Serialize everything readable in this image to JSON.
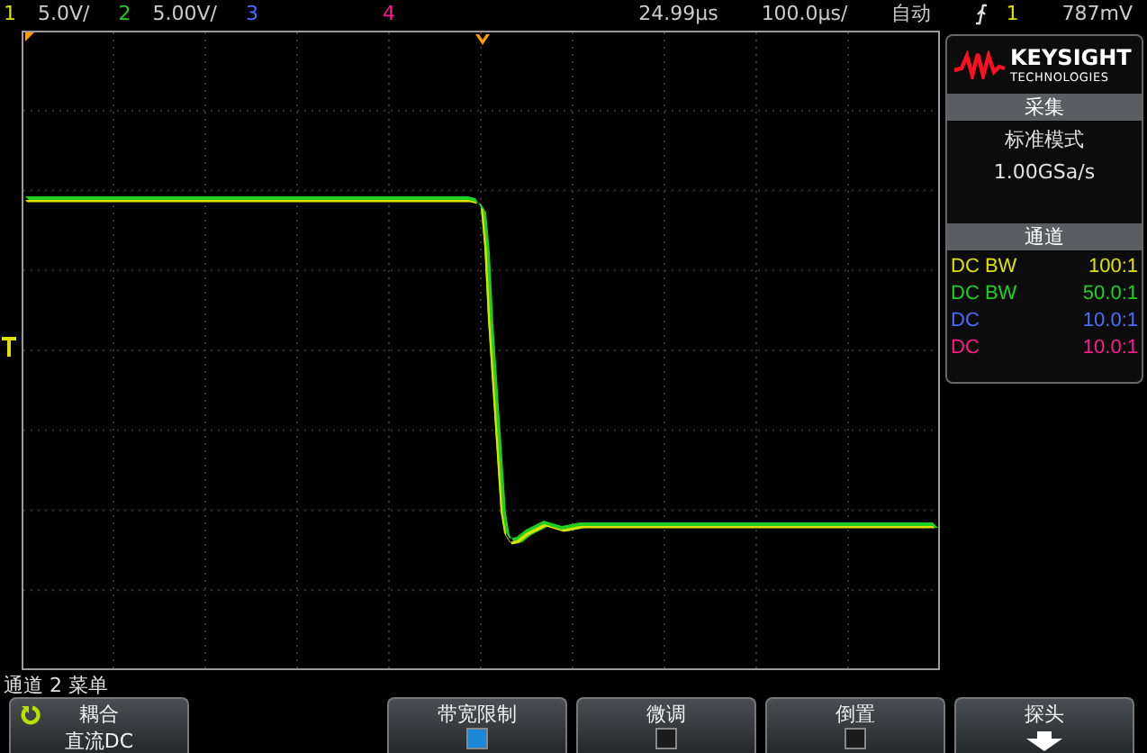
{
  "top_bar": {
    "channels": [
      {
        "number": "1",
        "scale": "5.0V/",
        "color": "#e0e000"
      },
      {
        "number": "2",
        "scale": "5.00V/",
        "color": "#20d020"
      },
      {
        "number": "3",
        "color": "#4a6cff"
      },
      {
        "number": "4",
        "color": "#ff1a8c"
      }
    ],
    "delay": "24.99µs",
    "timebase": "100.0µs/",
    "trigger_mode": "自动",
    "trigger_source": "1",
    "trigger_level": "787mV"
  },
  "sidebar": {
    "logo": {
      "brand": "KEYSIGHT",
      "subtitle": "TECHNOLOGIES"
    },
    "acquisition": {
      "header": "采集",
      "mode": "标准模式",
      "sample_rate": "1.00GSa/s"
    },
    "channels": {
      "header": "通道",
      "rows": [
        {
          "coupling": "DC BW",
          "probe": "100:1",
          "color": "#e0e000"
        },
        {
          "coupling": "DC BW",
          "probe": "50.0:1",
          "color": "#20d020"
        },
        {
          "coupling": "DC",
          "probe": "10.0:1",
          "color": "#4a6cff"
        },
        {
          "coupling": "DC",
          "probe": "10.0:1",
          "color": "#ff1a8c"
        }
      ]
    }
  },
  "menu": {
    "title": "通道 2 菜单",
    "softkeys": [
      {
        "kind": "cycle",
        "label": "耦合",
        "value": "直流DC"
      },
      {
        "kind": "blank"
      },
      {
        "kind": "checkbox",
        "label": "带宽限制",
        "checked": true
      },
      {
        "kind": "checkbox",
        "label": "微调",
        "checked": false
      },
      {
        "kind": "checkbox",
        "label": "倒置",
        "checked": false
      },
      {
        "kind": "submenu",
        "label": "探头"
      }
    ]
  }
}
